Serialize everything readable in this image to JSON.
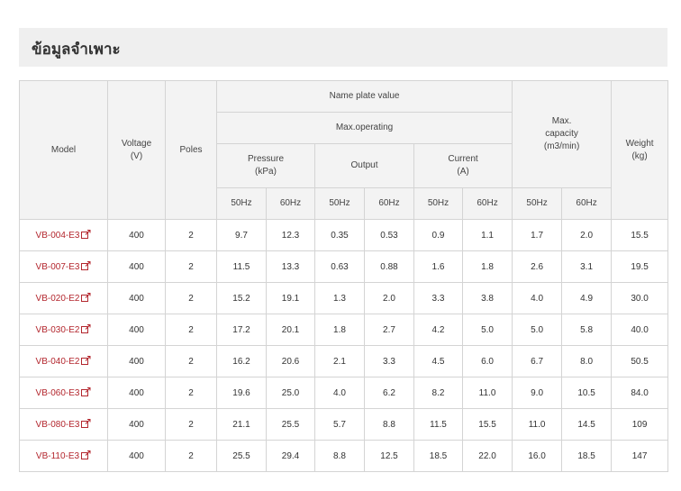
{
  "section": {
    "title": "ข้อมูลจำเพาะ"
  },
  "table": {
    "headers": {
      "model": "Model",
      "voltage": "Voltage\n(V)",
      "poles": "Poles",
      "name_plate": "Name plate value",
      "max_operating": "Max.operating",
      "pressure": "Pressure\n(kPa)",
      "output": "Output",
      "current": "Current\n(A)",
      "max_capacity": "Max.\ncapacity\n(m3/min)",
      "weight": "Weight\n(kg)",
      "hz50": "50Hz",
      "hz60": "60Hz"
    },
    "rows": [
      {
        "model": "VB-004-E3",
        "voltage": "400",
        "poles": "2",
        "p50": "9.7",
        "p60": "12.3",
        "o50": "0.35",
        "o60": "0.53",
        "c50": "0.9",
        "c60": "1.1",
        "m50": "1.7",
        "m60": "2.0",
        "weight": "15.5"
      },
      {
        "model": "VB-007-E3",
        "voltage": "400",
        "poles": "2",
        "p50": "11.5",
        "p60": "13.3",
        "o50": "0.63",
        "o60": "0.88",
        "c50": "1.6",
        "c60": "1.8",
        "m50": "2.6",
        "m60": "3.1",
        "weight": "19.5"
      },
      {
        "model": "VB-020-E2",
        "voltage": "400",
        "poles": "2",
        "p50": "15.2",
        "p60": "19.1",
        "o50": "1.3",
        "o60": "2.0",
        "c50": "3.3",
        "c60": "3.8",
        "m50": "4.0",
        "m60": "4.9",
        "weight": "30.0"
      },
      {
        "model": "VB-030-E2",
        "voltage": "400",
        "poles": "2",
        "p50": "17.2",
        "p60": "20.1",
        "o50": "1.8",
        "o60": "2.7",
        "c50": "4.2",
        "c60": "5.0",
        "m50": "5.0",
        "m60": "5.8",
        "weight": "40.0"
      },
      {
        "model": "VB-040-E2",
        "voltage": "400",
        "poles": "2",
        "p50": "16.2",
        "p60": "20.6",
        "o50": "2.1",
        "o60": "3.3",
        "c50": "4.5",
        "c60": "6.0",
        "m50": "6.7",
        "m60": "8.0",
        "weight": "50.5"
      },
      {
        "model": "VB-060-E3",
        "voltage": "400",
        "poles": "2",
        "p50": "19.6",
        "p60": "25.0",
        "o50": "4.0",
        "o60": "6.2",
        "c50": "8.2",
        "c60": "11.0",
        "m50": "9.0",
        "m60": "10.5",
        "weight": "84.0"
      },
      {
        "model": "VB-080-E3",
        "voltage": "400",
        "poles": "2",
        "p50": "21.1",
        "p60": "25.5",
        "o50": "5.7",
        "o60": "8.8",
        "c50": "11.5",
        "c60": "15.5",
        "m50": "11.0",
        "m60": "14.5",
        "weight": "109"
      },
      {
        "model": "VB-110-E3",
        "voltage": "400",
        "poles": "2",
        "p50": "25.5",
        "p60": "29.4",
        "o50": "8.8",
        "o60": "12.5",
        "c50": "18.5",
        "c60": "22.0",
        "m50": "16.0",
        "m60": "18.5",
        "weight": "147"
      }
    ],
    "link_icon": "external-link-icon"
  },
  "colors": {
    "link": "#b3262d",
    "header_bg": "#f3f3f3",
    "border": "#d4d4d4",
    "title_bar": "#efefef"
  }
}
